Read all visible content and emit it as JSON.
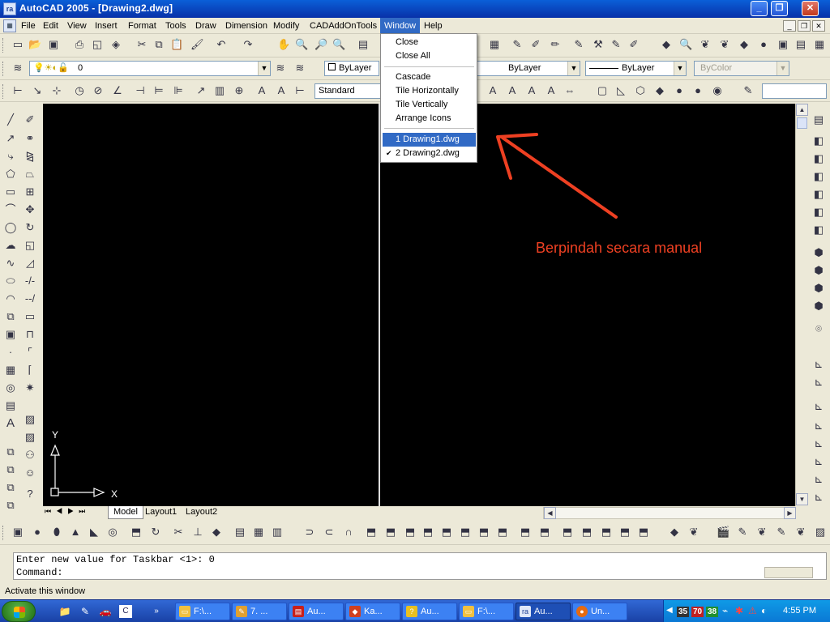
{
  "window": {
    "title": "AutoCAD 2005 - [Drawing2.dwg]",
    "app_icon_label": "ra"
  },
  "menubar": {
    "items": [
      "File",
      "Edit",
      "View",
      "Insert",
      "Format",
      "Tools",
      "Draw",
      "Dimension",
      "Modify",
      "CADAddOnTools",
      "Window",
      "Help"
    ],
    "active": "Window"
  },
  "properties_toolbar": {
    "layer_value": "0",
    "color_value": "ByLayer",
    "linetype_value": "ByLayer",
    "lineweight_value": "ByLayer",
    "plotstyle_value": "ByColor"
  },
  "styles_toolbar": {
    "text_style": "Standard"
  },
  "window_menu": {
    "items": [
      {
        "label": "Close"
      },
      {
        "label": "Close All"
      },
      {
        "label": "Cascade"
      },
      {
        "label": "Tile Horizontally"
      },
      {
        "label": "Tile Vertically"
      },
      {
        "label": "Arrange Icons"
      },
      {
        "label": "1 Drawing1.dwg",
        "highlighted": true
      },
      {
        "label": "2 Drawing2.dwg",
        "checked": true
      }
    ]
  },
  "annotation": {
    "text": "Berpindah secara manual",
    "color": "#ee4022"
  },
  "ucs_icon": {
    "x_label": "X",
    "y_label": "Y"
  },
  "layout_tabs": [
    "Model",
    "Layout1",
    "Layout2"
  ],
  "command_line": {
    "line1": "Enter new value for Taskbar <1>: 0",
    "line2": "Command:"
  },
  "status_bar": {
    "text": "Activate this window"
  },
  "taskbar": {
    "buttons": [
      {
        "label": "F:\\...",
        "icon": "folder-icon"
      },
      {
        "label": "7. ...",
        "icon": "app-icon"
      },
      {
        "label": "Au...",
        "icon": "pdf-icon"
      },
      {
        "label": "Ka...",
        "icon": "app-icon"
      },
      {
        "label": "Au...",
        "icon": "help-icon"
      },
      {
        "label": "F:\\...",
        "icon": "folder-icon"
      },
      {
        "label": "Au...",
        "icon": "autocad-icon",
        "active": true
      },
      {
        "label": "Un...",
        "icon": "firefox-icon"
      }
    ],
    "tray_badges": [
      "35",
      "70",
      "38"
    ],
    "clock": "4:55 PM"
  },
  "colors": {
    "accent": "#316ac5",
    "drawing_bg": "#000000",
    "titlebar": "#0a5fd8",
    "taskbar": "#245edb"
  }
}
